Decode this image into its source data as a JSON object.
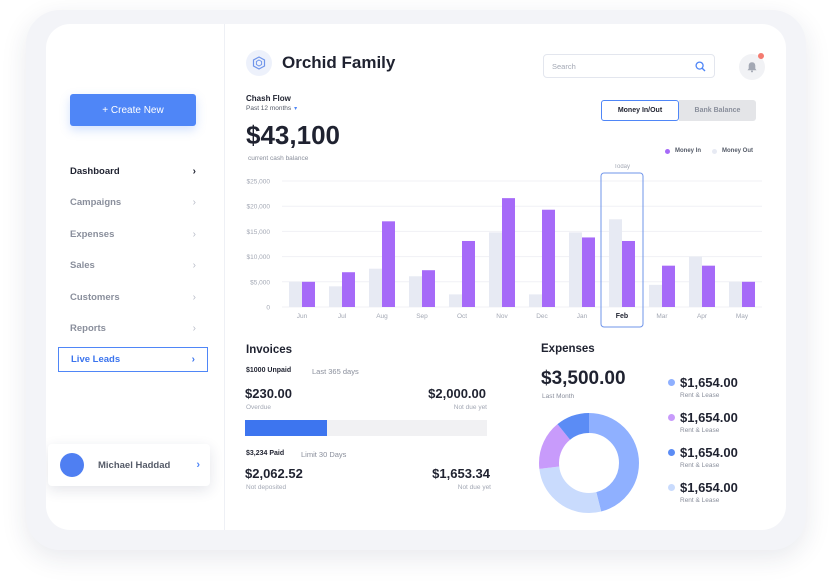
{
  "colors": {
    "accent": "#4f86f7",
    "money_in": "#a66af8",
    "money_out": "#e7eaf3",
    "donut": [
      "#8fb0ff",
      "#c9dbfd",
      "#c89bfb",
      "#5b8cf5"
    ]
  },
  "sidebar": {
    "create_label": "+ Create New",
    "items": [
      {
        "label": "Dashboard",
        "chev": "›"
      },
      {
        "label": "Campaigns",
        "chev": "›"
      },
      {
        "label": "Expenses",
        "chev": "›"
      },
      {
        "label": "Sales",
        "chev": "›"
      },
      {
        "label": "Customers",
        "chev": "›"
      },
      {
        "label": "Reports",
        "chev": "›"
      },
      {
        "label": "Live Leads",
        "chev": "›"
      }
    ],
    "user": {
      "name": "Michael Haddad",
      "chev": "›"
    }
  },
  "header": {
    "title": "Orchid Family",
    "search_placeholder": "Search",
    "logo_icon": "hexagon-logo-icon",
    "bell_icon": "bell-icon"
  },
  "cashflow": {
    "title": "Chash Flow",
    "period": "Past 12 months",
    "period_caret": "▾",
    "amount": "$43,100",
    "amount_label": "current cash balance",
    "toggle": [
      "Money In/Out",
      "Bank Balance"
    ],
    "legend": [
      "Money In",
      "Money Out"
    ],
    "today_label": "Today"
  },
  "chart_data": {
    "type": "bar",
    "categories": [
      "Jun",
      "Jul",
      "Aug",
      "Sep",
      "Oct",
      "Nov",
      "Dec",
      "Jan",
      "Feb",
      "Mar",
      "Apr",
      "May"
    ],
    "series": [
      {
        "name": "Money In",
        "values": [
          5000,
          6900,
          17000,
          7300,
          13100,
          21600,
          19300,
          13800,
          13100,
          8200,
          8200,
          5000
        ]
      },
      {
        "name": "Money Out",
        "values": [
          5000,
          4100,
          7600,
          6100,
          2500,
          14800,
          2500,
          14800,
          17400,
          4400,
          10000,
          5000
        ]
      }
    ],
    "yticks": [
      "$25,000",
      "$20,000",
      "$15,000",
      "$10,000",
      "$5,000",
      "0"
    ],
    "ylim": [
      0,
      25000
    ],
    "highlight_category": "Feb",
    "grid": true,
    "legend_position": "top-right"
  },
  "invoices": {
    "title": "Invoices",
    "unpaid_label": "$1000 Unpaid",
    "unpaid_period": "Last 365 days",
    "overdue_amount": "$230.00",
    "overdue_label": "Overdue",
    "not_due_amount": "$2,000.00",
    "not_due_label": "Not due yet",
    "progress": 0.34,
    "paid_label": "$3,234 Paid",
    "paid_period": "Limit 30 Days",
    "not_deposited_amount": "$2,062.52",
    "not_deposited_label": "Not deposited",
    "not_due_amount2": "$1,653.34",
    "not_due_label2": "Not due yet"
  },
  "expenses": {
    "title": "Expenses",
    "amount": "$3,500.00",
    "amount_label": "Last Month",
    "items": [
      {
        "value": "$1,654.00",
        "label": "Rent & Lease",
        "color": "#8fb0ff"
      },
      {
        "value": "$1,654.00",
        "label": "Rent & Lease",
        "color": "#c89bfb"
      },
      {
        "value": "$1,654.00",
        "label": "Rent & Lease",
        "color": "#5b8cf5"
      },
      {
        "value": "$1,654.00",
        "label": "Rent & Lease",
        "color": "#c9dbfd"
      }
    ],
    "donut_shares": [
      0.46,
      0.27,
      0.16,
      0.11
    ]
  }
}
